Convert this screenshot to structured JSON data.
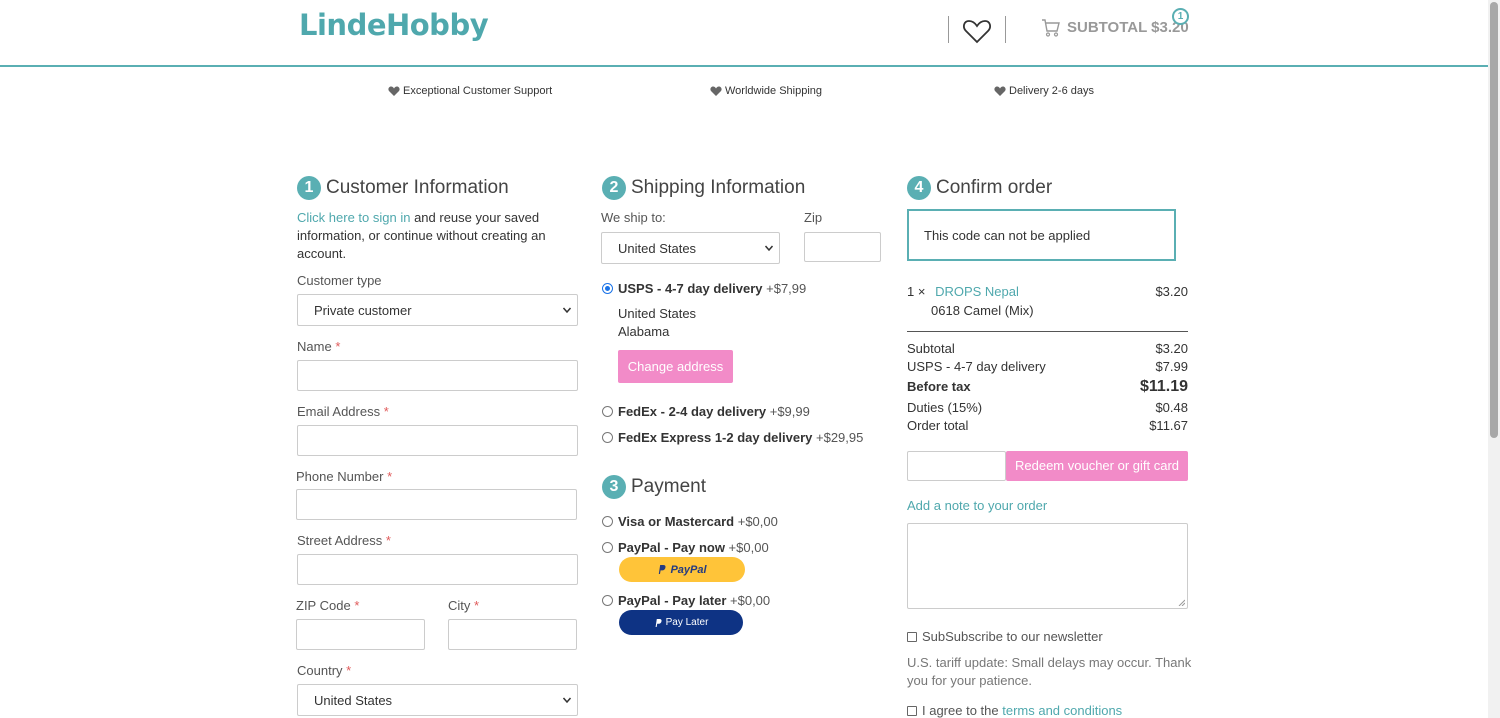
{
  "header": {
    "logo": "LindeHobby",
    "subtotal": "SUBTOTAL $3.20",
    "cart_count": "1"
  },
  "usps": [
    "Exceptional Customer Support",
    "Worldwide Shipping",
    "Delivery 2-6 days"
  ],
  "customer": {
    "step": "1",
    "title": "Customer Information",
    "signin_link": "Click here to sign in",
    "signin_rest_1": " and reuse your saved",
    "signin_rest_2": "information, or continue without creating an",
    "signin_rest_3": "account.",
    "type_label": "Customer type",
    "type_value": "Private customer",
    "name_label": "Name",
    "email_label": "Email Address",
    "phone_label": "Phone Number",
    "street_label": "Street Address",
    "zip_label": "ZIP Code",
    "city_label": "City",
    "country_label": "Country",
    "country_value": "United States",
    "required_mark": "*"
  },
  "shipping": {
    "step": "2",
    "title": "Shipping Information",
    "ship_to_label": "We ship to:",
    "ship_to_value": "United States",
    "zip_label": "Zip",
    "options": [
      {
        "name": "USPS - 4-7 day delivery",
        "price": " +$7,99"
      },
      {
        "name": "FedEx - 2-4 day delivery",
        "price": " +$9,99"
      },
      {
        "name": "FedEx Express 1-2 day delivery",
        "price": " +$29,95"
      }
    ],
    "address_country": "United States",
    "address_state": "Alabama",
    "change_address": "Change address"
  },
  "payment": {
    "step": "3",
    "title": "Payment",
    "options": [
      {
        "name": "Visa or Mastercard",
        "price": " +$0,00"
      },
      {
        "name": "PayPal - Pay now",
        "price": " +$0,00"
      },
      {
        "name": "PayPal - Pay later",
        "price": " +$0,00"
      }
    ],
    "paypal_btn": "PayPal",
    "paylater_btn": "Pay Later"
  },
  "confirm": {
    "step": "4",
    "title": "Confirm order",
    "notice": "This code can not be applied",
    "item_qty": "1 ×",
    "item_name": "DROPS Nepal",
    "item_variant": "0618 Camel (Mix)",
    "item_price": "$3.20",
    "rows": [
      {
        "label": "Subtotal",
        "value": "$3.20"
      },
      {
        "label": "USPS - 4-7 day delivery",
        "value": "$7.99"
      },
      {
        "label": "Before tax",
        "value": "$11.19"
      },
      {
        "label": "Duties (15%)",
        "value": "$0.48"
      },
      {
        "label": "Order total",
        "value": "$11.67"
      }
    ],
    "redeem_btn": "Redeem voucher or gift card",
    "add_note": "Add a note to your order",
    "newsletter": "SubSubscribe to our newsletter",
    "tariff_1": "U.S. tariff update: Small delays may occur. Thank",
    "tariff_2": "you for your patience.",
    "agree_prefix": "I agree to the ",
    "agree_link": "terms and conditions"
  },
  "colors": {
    "accent": "#5aafb3",
    "pink": "#f28bc8",
    "paypal_gold": "#ffc439",
    "paypal_blue": "#0e3384"
  }
}
